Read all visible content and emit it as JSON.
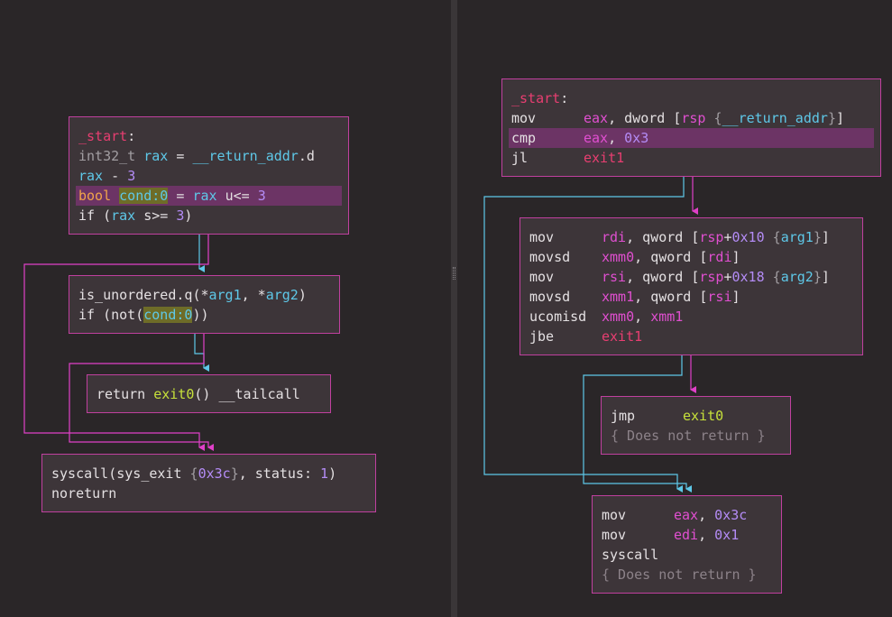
{
  "left_graph": {
    "n1": {
      "label": "_start",
      "l2": [
        "int32_t",
        "rax",
        "__return_addr",
        ".d"
      ],
      "l3": [
        "rax",
        "3"
      ],
      "l4": [
        "bool",
        "cond:0",
        "rax",
        "u<=",
        "3"
      ],
      "l5": [
        "if",
        "rax",
        "s>=",
        "3"
      ]
    },
    "n2": {
      "l1": [
        "is_unordered.q",
        "arg1",
        "arg2"
      ],
      "l2": [
        "if",
        "not",
        "cond:0"
      ]
    },
    "n3": {
      "l1": [
        "return",
        "exit0",
        "__tailcall"
      ]
    },
    "n4": {
      "l1": [
        "syscall",
        "sys_exit",
        "0x3c",
        "status",
        "1"
      ],
      "l2": "noreturn"
    }
  },
  "right_graph": {
    "b1": {
      "label": "_start",
      "r1": [
        "mov",
        "eax",
        "dword",
        "rsp",
        "__return_addr"
      ],
      "r2": [
        "cmp",
        "eax",
        "0x3"
      ],
      "r3": [
        "jl",
        "exit1"
      ]
    },
    "b2": {
      "r1": [
        "mov",
        "rdi",
        "qword",
        "rsp",
        "0x10",
        "arg1"
      ],
      "r2": [
        "movsd",
        "xmm0",
        "qword",
        "rdi"
      ],
      "r3": [
        "mov",
        "rsi",
        "qword",
        "rsp",
        "0x18",
        "arg2"
      ],
      "r4": [
        "movsd",
        "xmm1",
        "qword",
        "rsi"
      ],
      "r5": [
        "ucomisd",
        "xmm0",
        "xmm1"
      ],
      "r6": [
        "jbe",
        "exit1"
      ]
    },
    "b3": {
      "r1": [
        "jmp",
        "exit0"
      ],
      "r2": "{ Does not return }"
    },
    "b4": {
      "r1": [
        "mov",
        "eax",
        "0x3c"
      ],
      "r2": [
        "mov",
        "edi",
        "0x1"
      ],
      "r3": "syscall",
      "r4": "{ Does not return }"
    }
  },
  "colors": {
    "background": "#2a2628",
    "node_fill": "#3d3539",
    "node_border": "#c0409f",
    "edge_true": "#5ec8e8",
    "edge_false": "#e040c8",
    "highlight_row": "#6c3465"
  }
}
